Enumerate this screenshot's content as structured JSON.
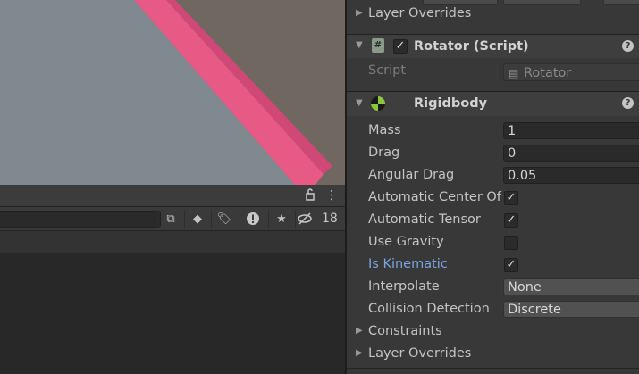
{
  "colors": {
    "scene_background": "#6f6760",
    "plane_gray": "#808890",
    "pink_stripe": "#e85a86",
    "accent_blue": "#7ba4e0"
  },
  "bottom_panel": {
    "hidden_count": "18",
    "icons": [
      "lock-icon",
      "kebab-menu-icon",
      "scene-link-icon",
      "type-filter-icon",
      "label-filter-icon",
      "warning-icon",
      "favorite-star-icon",
      "hidden-eye-icon"
    ]
  },
  "inspector": {
    "top_layer_overrides": "Layer Overrides",
    "rotator": {
      "title": "Rotator (Script)",
      "script_label": "Script",
      "script_value": "Rotator"
    },
    "rigidbody": {
      "title": "Rigidbody",
      "mass_label": "Mass",
      "mass_value": "1",
      "drag_label": "Drag",
      "drag_value": "0",
      "angular_drag_label": "Angular Drag",
      "angular_drag_value": "0.05",
      "auto_center_label": "Automatic Center Of",
      "auto_center_checked": true,
      "auto_tensor_label": "Automatic Tensor",
      "auto_tensor_checked": true,
      "use_gravity_label": "Use Gravity",
      "use_gravity_checked": false,
      "is_kinematic_label": "Is Kinematic",
      "is_kinematic_checked": true,
      "interpolate_label": "Interpolate",
      "interpolate_value": "None",
      "collision_label": "Collision Detection",
      "collision_value": "Discrete",
      "constraints_label": "Constraints",
      "layer_overrides_label": "Layer Overrides"
    }
  }
}
